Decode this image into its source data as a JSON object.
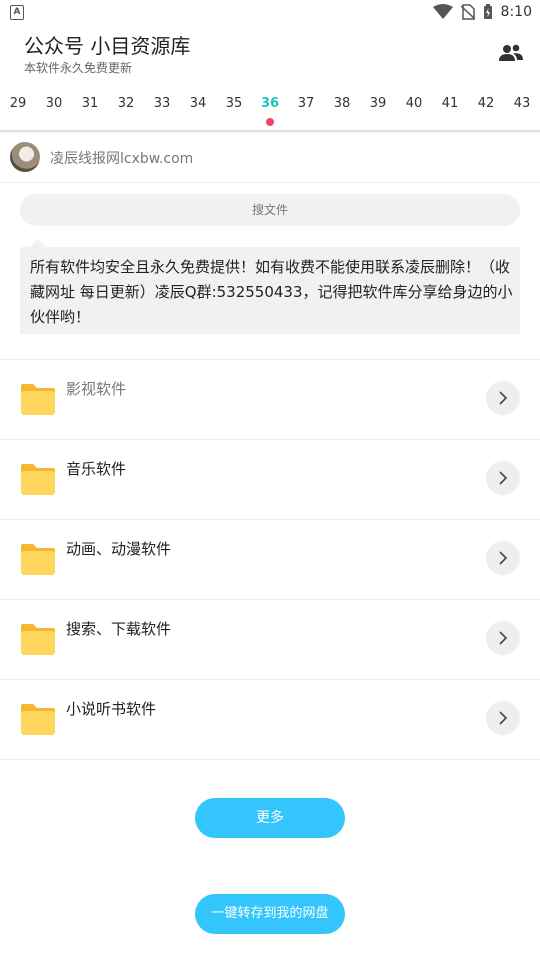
{
  "status_bar": {
    "time": "8:10",
    "app_glyph": "A"
  },
  "header": {
    "title": "公众号 小目资源库",
    "subtitle": "本软件永久免费更新"
  },
  "dates": {
    "items": [
      "29",
      "30",
      "31",
      "32",
      "33",
      "34",
      "35",
      "36",
      "37",
      "38",
      "39",
      "40",
      "41",
      "42",
      "43"
    ],
    "active": "36"
  },
  "author": {
    "name": "凌辰线报网lcxbw.com"
  },
  "search": {
    "placeholder": "搜文件"
  },
  "notice": {
    "text": "所有软件均安全且永久免费提供！如有收费不能使用联系凌辰删除！（收藏网址 每日更新）凌辰Q群:532550433，记得把软件库分享给身边的小伙伴哟！"
  },
  "categories": [
    {
      "label": "影视软件"
    },
    {
      "label": "音乐软件"
    },
    {
      "label": "动画、动漫软件"
    },
    {
      "label": "搜索、下载软件"
    },
    {
      "label": "小说听书软件"
    }
  ],
  "buttons": {
    "more": "更多",
    "save": "一键转存到我的网盘"
  },
  "colors": {
    "accent": "#33c5fb",
    "active_date": "#1ec4bb",
    "dot": "#f0446a",
    "folder": "#ffd65c"
  }
}
